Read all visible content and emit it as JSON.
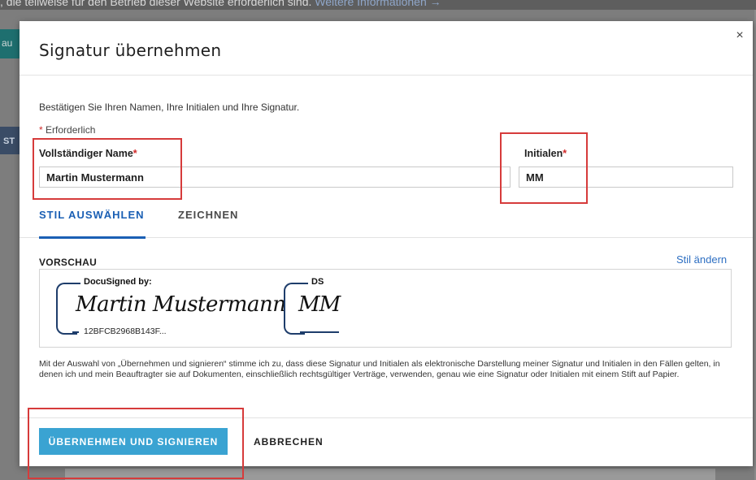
{
  "background": {
    "top_banner_text": ", die teilweise für den Betrieb dieser Website erforderlich sind.",
    "top_banner_link": "Weitere Informationen →",
    "left_tab_text": "au",
    "left_strip_text": "ST"
  },
  "modal": {
    "title": "Signatur übernehmen",
    "close_icon": "×",
    "intro": "Bestätigen Sie Ihren Namen, Ihre Initialen und Ihre Signatur.",
    "required_star": "*",
    "required_label": "Erforderlich",
    "fields": {
      "full_name": {
        "label": "Vollständiger Name",
        "star": "*",
        "value": "Martin Mustermann"
      },
      "initials": {
        "label": "Initialen",
        "star": "*",
        "value": "MM"
      }
    },
    "tabs": [
      {
        "label": "STIL AUSWÄHLEN",
        "active": true
      },
      {
        "label": "ZEICHNEN",
        "active": false
      }
    ],
    "preview": {
      "label": "VORSCHAU",
      "change_style": "Stil ändern",
      "signature": {
        "header": "DocuSigned by:",
        "script": "Martin Mustermann",
        "code": "12BFCB2968B143F..."
      },
      "initials": {
        "header": "DS",
        "script": "MM"
      }
    },
    "legal": "Mit der Auswahl von „Übernehmen und signieren“ stimme ich zu, dass diese Signatur und Initialen als elektronische Darstellung meiner Signatur und Initialen in den Fällen gelten, in denen ich und mein Beauftragter sie auf Dokumenten, einschließlich rechtsgültiger Verträge, verwenden, genau wie eine Signatur oder Initialen mit einem Stift auf Papier.",
    "buttons": {
      "submit": "ÜBERNEHMEN UND SIGNIEREN",
      "cancel": "ABBRECHEN"
    }
  },
  "colors": {
    "accent_blue": "#1a5fb4",
    "primary_button": "#3aa3d2",
    "required_red": "#d02a2a",
    "annotation_red": "#d63b3b"
  }
}
